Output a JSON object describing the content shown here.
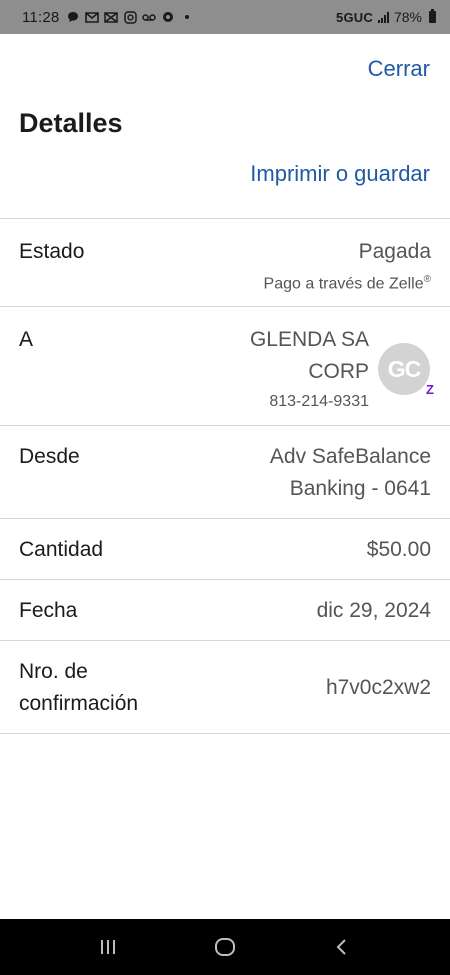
{
  "status_bar": {
    "time": "11:28",
    "network": "5GUC",
    "battery": "78%",
    "notification_icons": [
      "chat-bubble-icon",
      "gmail-icon",
      "mail-icon",
      "instagram-icon",
      "voicemail-icon",
      "chrome-icon",
      "dot-icon"
    ]
  },
  "header": {
    "close_label": "Cerrar",
    "title": "Detalles",
    "print_label": "Imprimir o guardar"
  },
  "details": {
    "status": {
      "label": "Estado",
      "value": "Pagada",
      "sub": "Pago a través de Zelle",
      "sub_mark": "®"
    },
    "to": {
      "label": "A",
      "name_line1": "GLENDA SA",
      "name_line2": "CORP",
      "phone": "813-214-9331",
      "initials": "GC",
      "badge": "Z"
    },
    "from": {
      "label": "Desde",
      "account_line1": "Adv SafeBalance",
      "account_line2": "Banking - 0641"
    },
    "amount": {
      "label": "Cantidad",
      "value": "$50.00"
    },
    "date": {
      "label": "Fecha",
      "value": "dic 29, 2024"
    },
    "confirmation": {
      "label_line1": "Nro. de",
      "label_line2": "confirmación",
      "value": "h7v0c2xw2"
    }
  },
  "colors": {
    "link": "#1f5aa6",
    "status_bar": "#8e8e8e",
    "divider": "#d8d8d8",
    "zelle": "#6d1ed4"
  }
}
